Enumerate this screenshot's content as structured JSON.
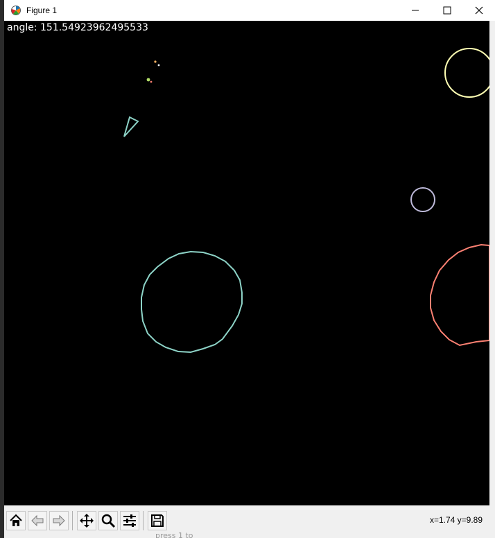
{
  "window": {
    "title": "Figure 1"
  },
  "game": {
    "angle_text": "angle: 151.54923962495533",
    "ship": {
      "angle_deg": 151.54923962495533,
      "color": "#8dd3c7"
    },
    "asteroid_colors": [
      "#ffffb3",
      "#bebada",
      "#fb8072",
      "#8dd3c7"
    ],
    "bullet_colors": [
      "#fdb462",
      "#ffffff",
      "#b3de69",
      "#fb8072"
    ]
  },
  "toolbar": {
    "buttons": [
      {
        "name": "home-button",
        "icon": "home-icon"
      },
      {
        "name": "back-button",
        "icon": "back-arrow-icon"
      },
      {
        "name": "forward-button",
        "icon": "forward-arrow-icon"
      },
      {
        "name": "pan-button",
        "icon": "pan-arrows-icon"
      },
      {
        "name": "zoom-button",
        "icon": "magnifier-icon"
      },
      {
        "name": "configure-subplots-button",
        "icon": "sliders-icon"
      },
      {
        "name": "save-button",
        "icon": "floppy-disk-icon"
      }
    ],
    "coords": "x=1.74 y=9.89"
  },
  "background_text": "press 1 to"
}
